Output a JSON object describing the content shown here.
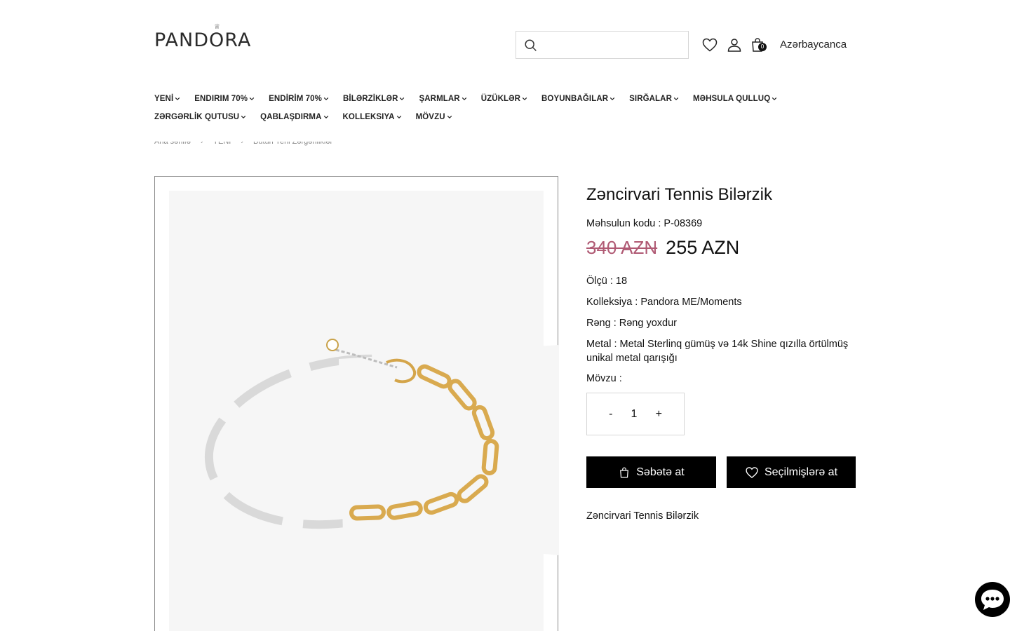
{
  "header": {
    "logo": "PANDORA",
    "search_placeholder": "",
    "cart_count": "0",
    "language": "Azərbaycanca"
  },
  "nav": {
    "row1": [
      {
        "label": "YENİ"
      },
      {
        "label": "ENDIRIM 70%"
      },
      {
        "label": "ENDİRİM 70%"
      },
      {
        "label": "BİLƏRZİKLƏR"
      },
      {
        "label": "ŞARMLAR"
      },
      {
        "label": "ÜZÜKLƏR"
      },
      {
        "label": "BOYUNBAĞILAR"
      },
      {
        "label": "SIRĞALAR"
      },
      {
        "label": "MƏHSULA QULLUQ"
      }
    ],
    "row2": [
      {
        "label": "ZƏRGƏRLİK QUTUSU"
      },
      {
        "label": "QABLAŞDIRMA"
      },
      {
        "label": "KOLLEKSIYA"
      },
      {
        "label": "MÖVZU"
      }
    ]
  },
  "breadcrumb": {
    "items": [
      "Ana səhifə",
      "YENİ",
      "Bütün Yeni Zərgənliklər"
    ],
    "separator": "›"
  },
  "product": {
    "title": "Zəncirvari Tennis Bilərzik",
    "code_label": "Məhsulun kodu : P-08369",
    "old_price": "340 AZN",
    "new_price": "255 AZN",
    "size": "Ölçü : 18",
    "collection": "Kolleksiya : Pandora ME/Moments",
    "color": "Rəng : Rəng yoxdur",
    "metal": "Metal : Metal Sterlinq gümüş və 14k Shine qızılla örtülmüş unikal metal qarışığı",
    "theme": "Mövzu :",
    "qty_minus": "-",
    "qty_value": "1",
    "qty_plus": "+",
    "add_to_cart": "Səbətə at",
    "add_to_favorites": "Seçilmişlərə at",
    "description": "Zəncirvari Tennis Bilərzik"
  }
}
